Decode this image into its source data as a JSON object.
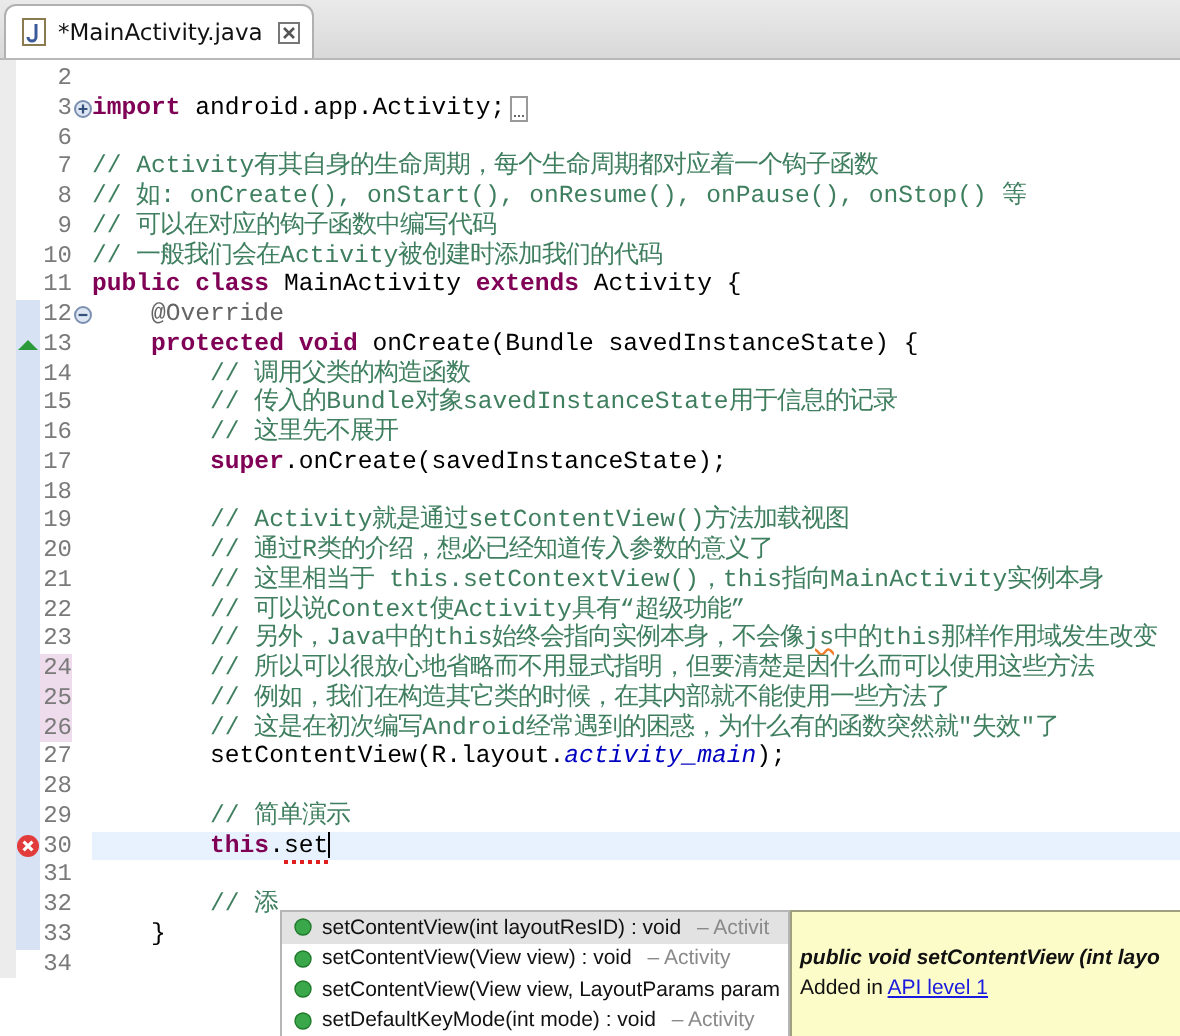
{
  "tab": {
    "title": "*MainActivity.java"
  },
  "lines": [
    {
      "number": "2",
      "changed": false
    },
    {
      "number": "3",
      "changed": false,
      "collapsed": true,
      "tokens": [
        {
          "kind": "keyword",
          "text": "import"
        },
        {
          "kind": "plain",
          "text": " android.app.Activity;"
        }
      ]
    },
    {
      "number": "6",
      "changed": false
    },
    {
      "number": "7",
      "changed": false,
      "tokens": [
        {
          "kind": "comment",
          "text": "// Activity有其自身的生命周期，每个生命周期都对应着一个钩子函数"
        }
      ]
    },
    {
      "number": "8",
      "changed": false,
      "tokens": [
        {
          "kind": "comment",
          "text": "// 如: onCreate(), onStart(), onResume(), onPause(), onStop() 等"
        }
      ]
    },
    {
      "number": "9",
      "changed": false,
      "tokens": [
        {
          "kind": "comment",
          "text": "// 可以在对应的钩子函数中编写代码"
        }
      ]
    },
    {
      "number": "10",
      "changed": false,
      "tokens": [
        {
          "kind": "comment",
          "text": "// 一般我们会在Activity被创建时添加我们的代码"
        }
      ]
    },
    {
      "number": "11",
      "changed": false,
      "tokens": [
        {
          "kind": "keyword",
          "text": "public class"
        },
        {
          "kind": "plain",
          "text": " MainActivity "
        },
        {
          "kind": "keyword",
          "text": "extends"
        },
        {
          "kind": "plain",
          "text": " Activity {"
        }
      ]
    },
    {
      "number": "12",
      "changed": true,
      "collapsed": false,
      "tokens": [
        {
          "kind": "annotation",
          "text": "    @Override"
        }
      ]
    },
    {
      "number": "13",
      "changed": true,
      "overrides": true,
      "tokens": [
        {
          "kind": "keyword",
          "text": "    protected void"
        },
        {
          "kind": "plain",
          "text": " onCreate(Bundle savedInstanceState) {"
        }
      ]
    },
    {
      "number": "14",
      "changed": true,
      "tokens": [
        {
          "kind": "comment",
          "text": "        // 调用父类的构造函数"
        }
      ]
    },
    {
      "number": "15",
      "changed": true,
      "tokens": [
        {
          "kind": "comment",
          "text": "        // 传入的Bundle对象savedInstanceState用于信息的记录"
        }
      ]
    },
    {
      "number": "16",
      "changed": true,
      "tokens": [
        {
          "kind": "comment",
          "text": "        // 这里先不展开"
        }
      ]
    },
    {
      "number": "17",
      "changed": true,
      "tokens": [
        {
          "kind": "keyword",
          "text": "        super"
        },
        {
          "kind": "plain",
          "text": ".onCreate(savedInstanceState);"
        }
      ]
    },
    {
      "number": "18",
      "changed": true
    },
    {
      "number": "19",
      "changed": true,
      "tokens": [
        {
          "kind": "comment",
          "text": "        // Activity就是通过setContentView()方法加载视图"
        }
      ]
    },
    {
      "number": "20",
      "changed": true,
      "tokens": [
        {
          "kind": "comment",
          "text": "        // 通过R类的介绍，想必已经知道传入参数的意义了"
        }
      ]
    },
    {
      "number": "21",
      "changed": true,
      "tokens": [
        {
          "kind": "comment",
          "text": "        // 这里相当于 this.setContextView()，this指向MainActivity实例本身"
        }
      ]
    },
    {
      "number": "22",
      "changed": true,
      "tokens": [
        {
          "kind": "comment",
          "text": "        // 可以说Context使Activity具有“超级功能”"
        }
      ]
    },
    {
      "number": "23",
      "changed": true,
      "tokens": [
        {
          "kind": "comment",
          "text": "        // 另外，Java中的this始终会指向实例本身，不会像"
        },
        {
          "kind": "spelling",
          "text": "js"
        },
        {
          "kind": "comment",
          "text": "中的this那样作用域发生改变"
        }
      ]
    },
    {
      "number": "24",
      "changed": true,
      "added": true,
      "tokens": [
        {
          "kind": "comment",
          "text": "        // 所以可以很放心地省略而不用显式指明，但要清楚是因什么而可以使用这些方法"
        }
      ]
    },
    {
      "number": "25",
      "changed": true,
      "added": true,
      "tokens": [
        {
          "kind": "comment",
          "text": "        // 例如，我们在构造其它类的时候，在其内部就不能使用一些方法了"
        }
      ]
    },
    {
      "number": "26",
      "changed": true,
      "added": true,
      "tokens": [
        {
          "kind": "comment",
          "text": "        // 这是在初次编写Android经常遇到的困惑，为什么有的函数突然就\"失效\"了"
        }
      ]
    },
    {
      "number": "27",
      "changed": true,
      "tokens": [
        {
          "kind": "plain",
          "text": "        setContentView(R.layout."
        },
        {
          "kind": "field",
          "text": "activity_main"
        },
        {
          "kind": "plain",
          "text": ");"
        }
      ]
    },
    {
      "number": "28",
      "changed": true
    },
    {
      "number": "29",
      "changed": true,
      "tokens": [
        {
          "kind": "comment",
          "text": "        // 简单演示"
        }
      ]
    },
    {
      "number": "30",
      "changed": true,
      "error": true,
      "current": true,
      "tokens": [
        {
          "kind": "keyword",
          "text": "        this"
        },
        {
          "kind": "plain",
          "text": "."
        },
        {
          "kind": "error",
          "text": "set"
        }
      ]
    },
    {
      "number": "31",
      "changed": true
    },
    {
      "number": "32",
      "changed": true,
      "tokens": [
        {
          "kind": "comment",
          "text": "        // 添"
        }
      ]
    },
    {
      "number": "33",
      "changed": true,
      "tokens": [
        {
          "kind": "plain",
          "text": "    }"
        }
      ]
    },
    {
      "number": "34",
      "changed": false
    }
  ],
  "completion": {
    "items": [
      {
        "signature": "setContentView(int layoutResID) : void",
        "owner": "– Activit",
        "selected": true
      },
      {
        "signature": "setContentView(View view) : void",
        "owner": "– Activity",
        "selected": false
      },
      {
        "signature": "setContentView(View view, LayoutParams param",
        "selected": false
      },
      {
        "signature": "setDefaultKeyMode(int mode) : void",
        "owner": "– Activity",
        "selected": false
      }
    ]
  },
  "doc": {
    "signature": "public void setContentView (int layo",
    "added_prefix": "Added in ",
    "added_link": "API level 1"
  }
}
